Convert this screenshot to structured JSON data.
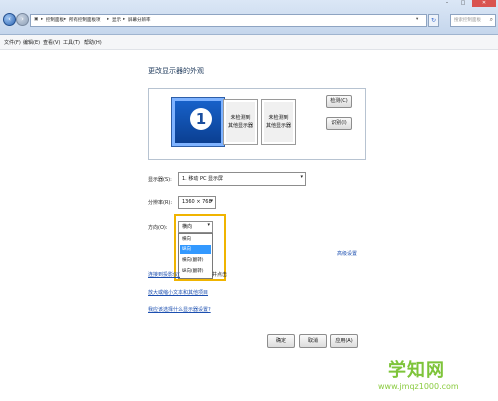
{
  "address_bar": {
    "crumbs": [
      "控制面板",
      "所有控制面板项",
      "显示",
      "屏幕分辨率"
    ],
    "search_placeholder": "搜索控制面板"
  },
  "menu": [
    "文件(F)",
    "编辑(E)",
    "查看(V)",
    "工具(T)",
    "帮助(H)"
  ],
  "page": {
    "heading": "更改显示器的外观",
    "monitor_primary_number": "1",
    "monitor_secondary_a": [
      "未检测到",
      "其他显示器"
    ],
    "monitor_secondary_b": [
      "未检测到",
      "其他显示器"
    ],
    "detect_button": "检测(C)",
    "identify_button": "识别(I)",
    "display_label": "显示器(S):",
    "display_value": "1. 移动 PC 显示屏",
    "resolution_label": "分辨率(R):",
    "resolution_value": "1360 × 768",
    "orientation_label": "方向(O):",
    "orientation_value": "横向",
    "orientation_options": [
      "横向",
      "纵向",
      "横向(翻转)",
      "纵向(翻转)"
    ],
    "orientation_selected_index": 1,
    "advanced_link": "高级设置",
    "connect_projector_link": "连接到投影仪(",
    "connect_projector_tail": "并点击",
    "text_size_link": "放大或缩小文本和其他项目",
    "which_settings_link": "我应该选择什么显示器设置?",
    "ok_button": "确定",
    "cancel_button": "取消",
    "apply_button": "应用(A)"
  },
  "watermark": {
    "brand": "学知网",
    "url": "www.jmqz1000.com"
  },
  "colors": {
    "highlight": "#f0b400",
    "selection": "#3399ff",
    "link": "#1c4fb0",
    "watermark": "#7ec43a"
  }
}
